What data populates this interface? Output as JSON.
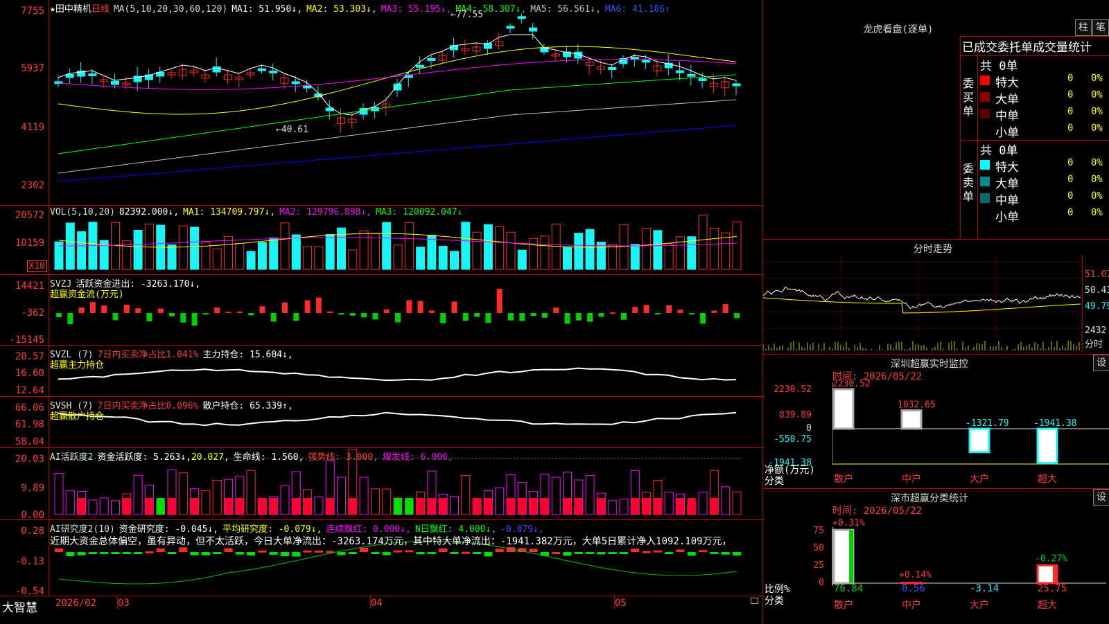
{
  "colors": {
    "up": "#ff2a2a",
    "down": "#19f4f4",
    "bg": "#000000",
    "grid": "#c00000",
    "ma1": "#ffffff",
    "ma2": "#ffff00",
    "ma3": "#ff00ff",
    "ma4": "#00ff00",
    "ma5": "#c0c0c0",
    "ma6": "#0000ff"
  },
  "price": {
    "stock_name": "★田中精机",
    "period": "日线",
    "ma_label": "MA(5,10,20,30,60,120)",
    "ma1": "MA1: 51.950↓,",
    "ma2": "MA2: 53.303↓,",
    "ma3": "MA3: 55.195↓,",
    "ma4": "MA4: 58.307↓,",
    "ma5": "MA5: 56.561↓,",
    "ma6": "MA6: 41.186↑",
    "high_mark": "←77.55",
    "low_mark": "←40.61",
    "y_labels": [
      "7755",
      "5937",
      "4119",
      "2302"
    ]
  },
  "vol": {
    "label": "VOL(5,10,20)",
    "value": "82392.000↓,",
    "ma1": "MA1: 134709.797↓,",
    "ma2": "MA2: 129796.898↓,",
    "ma3": "MA3: 120092.047↓",
    "y_labels": [
      "20572",
      "10159"
    ],
    "unit": "X10"
  },
  "svzj": {
    "label": "SVZJ",
    "value": "活跃资金进出: -3263.170↓,",
    "subtitle": "超赢资金流(万元)",
    "y_labels": [
      "14421",
      "-362",
      "-15145"
    ]
  },
  "svzl": {
    "label": "SVZL (7)",
    "ratio": "7日内买卖净占比1.041%",
    "value": "主力持仓: 15.604↓,",
    "subtitle": "超赢主力持仓",
    "y_labels": [
      "20.57",
      "16.60",
      "12.64"
    ]
  },
  "svsh": {
    "label": "SVSH (7)",
    "ratio": "7日内买卖净占比0.096%",
    "value": "散户持仓: 65.339↑,",
    "subtitle": "超赢散户持仓",
    "y_labels": [
      "66.06",
      "61.98",
      "58.04"
    ]
  },
  "ai_active": {
    "label": "AI活跃度2",
    "v1": "资金活跃度: 5.263↓,",
    "v2": "20.027,",
    "v3": "生命线: 1.560,",
    "v4": "强势线: 3.000,",
    "v5": "爆发线: 6.000,",
    "y_labels": [
      "20.03",
      "9.89",
      "0.00"
    ]
  },
  "ai_research": {
    "label": "AI研究度2(10)",
    "v1": "资金研究度: -0.045↓,",
    "v2": "平均研究度: -0.079↓,",
    "v3": "连续飘红: 0.000↓,",
    "v4": "N日飘红: 4.000↓,",
    "v5": "-0.079↓,",
    "comment": "近期大资金总体偏空，虽有异动，但不太活跃，今日大单净流出：-3263.174万元，其中特大单净流出：-1941.382万元，大单5日累计净入1092.109万元，",
    "y_labels": [
      "0.28",
      "-0.13",
      "-0.54"
    ]
  },
  "xaxis": {
    "brand": "大智慧",
    "labels": [
      "2026/02",
      "03",
      "04",
      "05"
    ]
  },
  "lhb": {
    "title": "龙虎看盘(逐单)",
    "btn1": "柱",
    "btn2": "笔",
    "header": "已成交委托单成交量统计",
    "buy": {
      "side": "委买单",
      "total": "共 0单",
      "rows": [
        {
          "name": "特大",
          "v": "0",
          "p": "0%",
          "c": "#ff0000"
        },
        {
          "name": "大单",
          "v": "0",
          "p": "0%",
          "c": "#8b0000"
        },
        {
          "name": "中单",
          "v": "0",
          "p": "0%",
          "c": "#5a0000"
        },
        {
          "name": "小单",
          "v": "0",
          "p": "0%",
          "c": ""
        }
      ]
    },
    "sell": {
      "side": "委卖单",
      "total": "共 0单",
      "rows": [
        {
          "name": "特大",
          "v": "0",
          "p": "0%",
          "c": "#00ffff"
        },
        {
          "name": "大单",
          "v": "0",
          "p": "0%",
          "c": "#008b8b"
        },
        {
          "name": "中单",
          "v": "0",
          "p": "0%",
          "c": "#006b6b"
        },
        {
          "name": "小单",
          "v": "0",
          "p": "0%",
          "c": ""
        }
      ]
    }
  },
  "intraday": {
    "title": "分时走势",
    "labels": [
      "51.07",
      "50.43",
      "49.79",
      "2432",
      "分时"
    ]
  },
  "monitor": {
    "title": "深圳超赢实时监控",
    "btn": "设",
    "time": "时间: 2026/05/22",
    "y_labels": [
      "2230.52",
      "839.89",
      "0",
      "-550.75",
      "-1941.38"
    ],
    "side_label1": "净额(万元)",
    "side_label2": "分类",
    "cats": [
      "散户",
      "中户",
      "大户",
      "超大"
    ],
    "values": [
      2230.52,
      1032.65,
      -1321.79,
      -1941.38
    ],
    "value_labels": [
      "2230.52",
      "1032.65",
      "-1321.79",
      "-1941.38"
    ]
  },
  "stats": {
    "title": "深市超赢分类统计",
    "btn": "设",
    "time": "时间: 2026/05/22",
    "y_labels": [
      "75",
      "50",
      "25",
      "0"
    ],
    "side_label1": "比例%",
    "side_label2": "分类",
    "cats": [
      "散户",
      "中户",
      "大户",
      "超大"
    ],
    "ratios": [
      76.84,
      0.56,
      -3.14,
      25.75
    ],
    "ratio_labels": [
      "76.84",
      "0.56",
      "-3.14",
      "25.75"
    ],
    "changes": [
      "+0.31%",
      "+0.14%",
      "",
      "-0.27%"
    ]
  }
}
